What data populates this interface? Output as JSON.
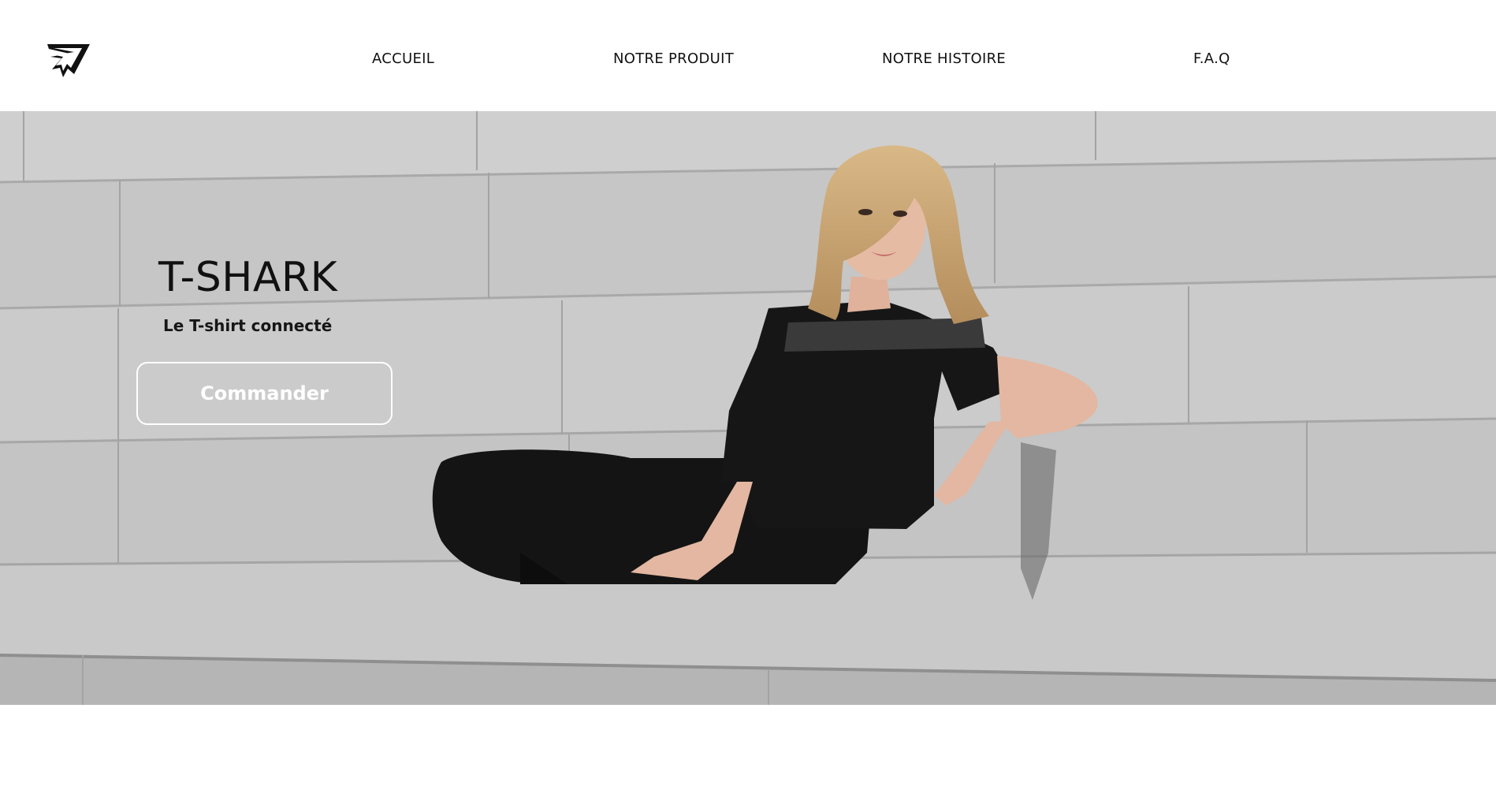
{
  "header": {
    "logo_icon": "shark-logo-icon",
    "nav": [
      {
        "label": "ACCUEIL"
      },
      {
        "label": "NOTRE PRODUIT"
      },
      {
        "label": "NOTRE HISTOIRE"
      },
      {
        "label": "F.A.Q"
      }
    ]
  },
  "hero": {
    "title": "T-SHARK",
    "subtitle": "Le T-shirt connecté",
    "button_label": "Commander",
    "image_subject": "woman in black t-shirt and leggings seated on granite steps"
  },
  "colors": {
    "background": "#ffffff",
    "text": "#111111",
    "stone": "#c8c8c8",
    "outfit": "#141414"
  }
}
